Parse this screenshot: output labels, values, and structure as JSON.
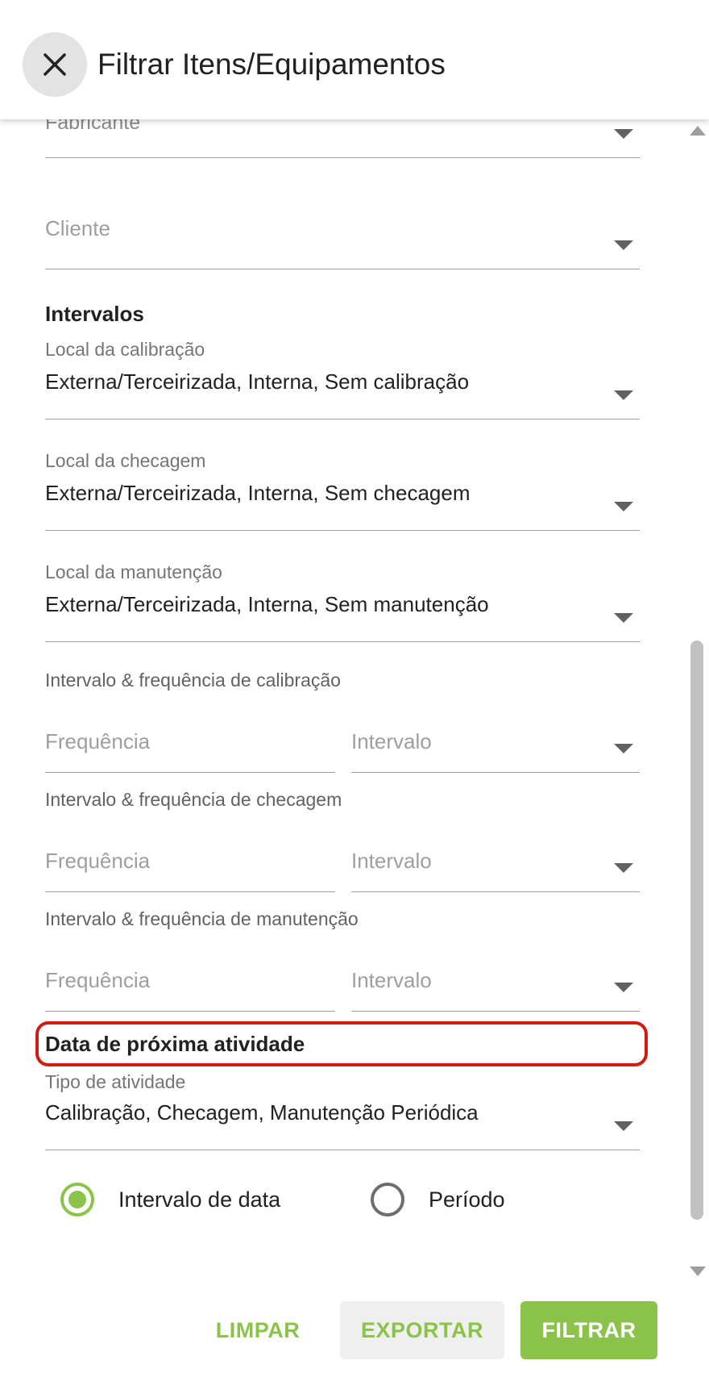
{
  "header": {
    "title": "Filtrar Itens/Equipamentos"
  },
  "filters": {
    "fabricante": {
      "label": "Fabricante"
    },
    "cliente": {
      "placeholder": "Cliente"
    }
  },
  "intervalos": {
    "title": "Intervalos",
    "local_calibracao": {
      "label": "Local da calibração",
      "value": "Externa/Terceirizada, Interna, Sem calibração"
    },
    "local_checagem": {
      "label": "Local da checagem",
      "value": "Externa/Terceirizada, Interna, Sem checagem"
    },
    "local_manutencao": {
      "label": "Local da manutenção",
      "value": "Externa/Terceirizada, Interna, Sem manutenção"
    },
    "freq_calibracao": {
      "label": "Intervalo & frequência de calibração",
      "freq_placeholder": "Frequência",
      "interval_placeholder": "Intervalo"
    },
    "freq_checagem": {
      "label": "Intervalo & frequência de checagem",
      "freq_placeholder": "Frequência",
      "interval_placeholder": "Intervalo"
    },
    "freq_manutencao": {
      "label": "Intervalo & frequência de manutenção",
      "freq_placeholder": "Frequência",
      "interval_placeholder": "Intervalo"
    }
  },
  "proxima_atividade": {
    "title": "Data de próxima atividade",
    "tipo": {
      "label": "Tipo de atividade",
      "value": "Calibração, Checagem, Manutenção Periódica"
    },
    "radio_options": [
      {
        "label": "Intervalo de data",
        "checked": true
      },
      {
        "label": "Período",
        "checked": false
      }
    ]
  },
  "footer": {
    "clear_label": "LIMPAR",
    "export_label": "EXPORTAR",
    "filter_label": "FILTRAR"
  },
  "colors": {
    "accent": "#8bc34a",
    "highlight": "#d41b0f"
  }
}
